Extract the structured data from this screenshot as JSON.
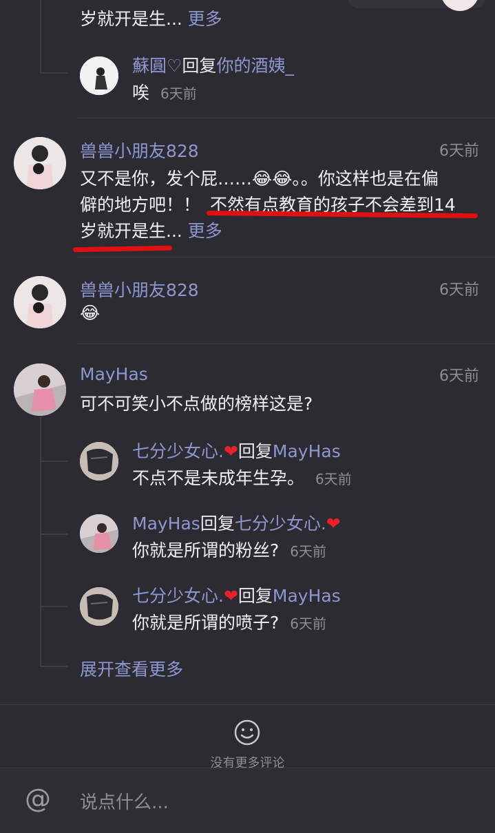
{
  "top": {
    "truncated_text": "岁就开是生...",
    "more": "更多"
  },
  "reply_su": {
    "author": "蘇圓♡",
    "reply_word": "回复",
    "target": "你的酒姨_",
    "text": "唉",
    "time": "6天前"
  },
  "comment1": {
    "author": "兽兽小朋友828",
    "time": "6天前",
    "line1": "又不是你，发个屁……😂😂。。你这样也是在偏",
    "line2a": "僻的地方吧！！",
    "line2b": "不然有点教育的孩子不会差到14",
    "line3": "岁就开是生...",
    "more": "更多"
  },
  "comment2": {
    "author": "兽兽小朋友828",
    "time": "6天前",
    "text": "😂"
  },
  "comment3": {
    "author": "MayHas",
    "time": "6天前",
    "text": "可不可笑小不点做的榜样这是?",
    "replies": [
      {
        "author": "七分少女心.",
        "heart": "❤",
        "reply_word": "回复",
        "target": "MayHas",
        "text": "不点不是未成年生孕。",
        "time": "6天前"
      },
      {
        "author": "MayHas",
        "reply_word": "回复",
        "target": "七分少女心.",
        "heart": "❤",
        "text": "你就是所谓的粉丝?",
        "time": "6天前"
      },
      {
        "author": "七分少女心.",
        "heart": "❤",
        "reply_word": "回复",
        "target": "MayHas",
        "text": "你就是所谓的喷子?",
        "time": "6天前"
      }
    ],
    "expand": "展开查看更多"
  },
  "footer": {
    "no_more": "没有更多评论"
  },
  "input": {
    "at_symbol": "@",
    "placeholder": "说点什么..."
  },
  "colors": {
    "background": "#2b2b31",
    "name": "#8e97d1",
    "annotation_red": "#e01010",
    "heart": "#e8212c"
  }
}
